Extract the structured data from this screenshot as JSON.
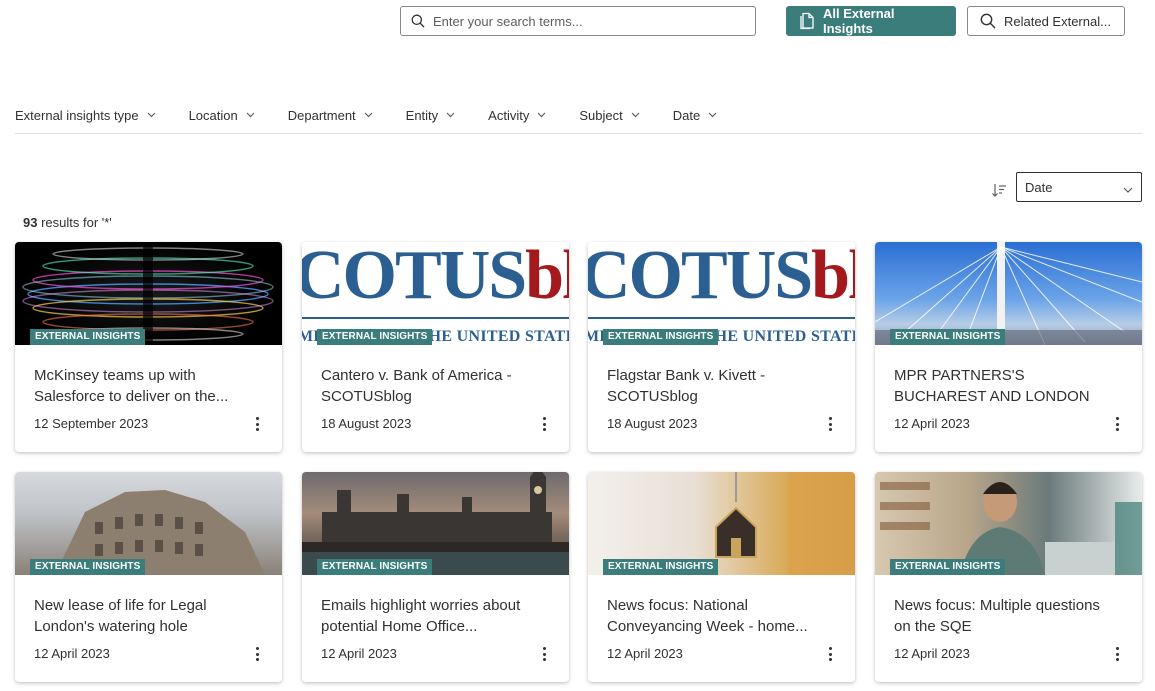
{
  "search": {
    "placeholder": "Enter your search terms..."
  },
  "buttons": {
    "primary_label": "All External Insights",
    "secondary_label": "Related External..."
  },
  "filters": [
    "External insights type",
    "Location",
    "Department",
    "Entity",
    "Activity",
    "Subject",
    "Date"
  ],
  "sort": {
    "selected": "Date"
  },
  "results": {
    "count": "93",
    "suffix": " results for '*'"
  },
  "badge_label": "EXTERNAL INSIGHTS",
  "scotus": {
    "main_blue": "COTUS",
    "main_red": "blo",
    "sub": "ME COURT OF THE UNITED STATES"
  },
  "cards": [
    {
      "title": "McKinsey teams up with Salesforce to deliver on the...",
      "date": "12 September 2023",
      "image": "spiral-light"
    },
    {
      "title": "Cantero v. Bank of America - SCOTUSblog",
      "date": "18 August 2023",
      "image": "scotusblog-logo"
    },
    {
      "title": "Flagstar Bank v. Kivett - SCOTUSblog",
      "date": "18 August 2023",
      "image": "scotusblog-logo"
    },
    {
      "title": "MPR PARTNERS'S BUCHAREST AND LONDON OFFICES SEES...",
      "date": "12 April 2023",
      "image": "cable-bridge"
    },
    {
      "title": "New lease of life for Legal London's watering hole",
      "date": "12 April 2023",
      "image": "london-building"
    },
    {
      "title": "Emails highlight worries about potential Home Office...",
      "date": "12 April 2023",
      "image": "houses-of-parliament"
    },
    {
      "title": "News focus: National Conveyancing Week - home...",
      "date": "12 April 2023",
      "image": "house-keys"
    },
    {
      "title": "News focus: Multiple questions on the SQE",
      "date": "12 April 2023",
      "image": "man-at-laptop"
    }
  ],
  "colors": {
    "accent": "#3a7d7a",
    "text": "#323130",
    "scotus_blue": "#2b5f92",
    "scotus_red": "#a3191c"
  }
}
